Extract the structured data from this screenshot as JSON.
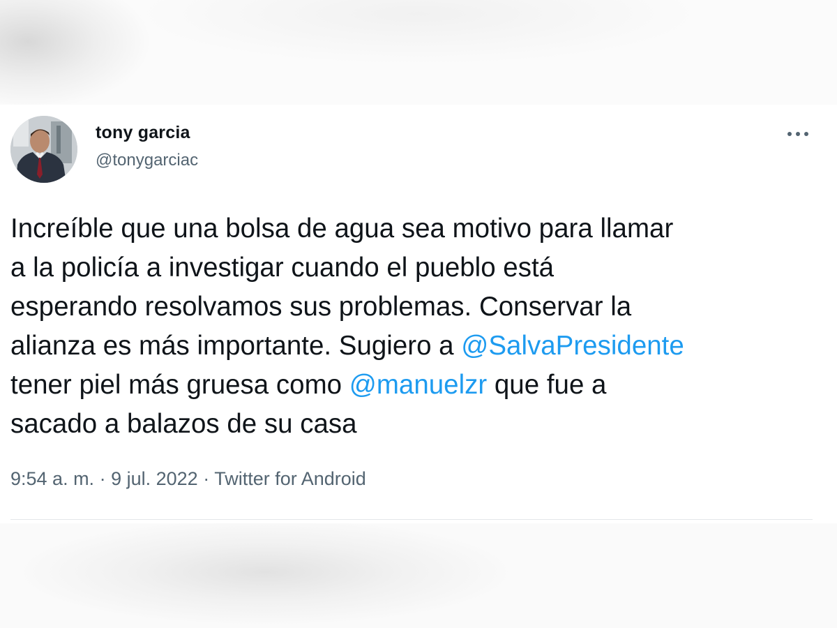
{
  "tweet": {
    "author": {
      "display_name": "tony garcia",
      "handle": "@tonygarciac"
    },
    "more_icon": "more-horizontal-icon",
    "text": {
      "line1": "Increíble que una bolsa de agua sea motivo para llamar",
      "line2": "a la policía a investigar cuando el pueblo está",
      "line3": "esperando resolvamos sus problemas. Conservar la",
      "line4_prefix": "alianza es más importante. Sugiero a ",
      "mention1": "@SalvaPresidente",
      "line5_prefix": "tener piel más gruesa como ",
      "mention2": "@manuelzr",
      "line5_suffix": " que fue a",
      "line6": "sacado a balazos de su casa"
    },
    "meta": {
      "time": "9:54 a. m.",
      "separator1": " · ",
      "date": "9 jul. 2022",
      "separator2": " · ",
      "source": "Twitter for Android"
    }
  },
  "colors": {
    "text": "#0f1419",
    "secondary": "#536471",
    "mention": "#1d9bf0",
    "divider": "#e4e7ea"
  }
}
